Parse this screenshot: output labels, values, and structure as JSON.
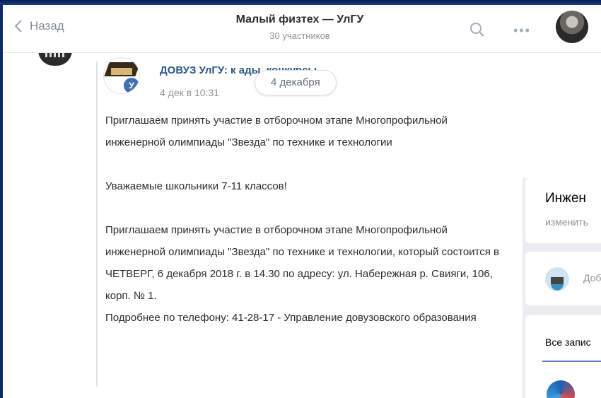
{
  "header": {
    "back_label": "Назад",
    "title": "Малый физтех — УлГУ",
    "subtitle": "30 участников"
  },
  "post": {
    "author": "ДОВУЗ УлГУ: к                 ады, конкурсы",
    "time": "4 дек в 10:31",
    "date_pill": "4 декабря",
    "avatar_letter": "У",
    "paragraphs": [
      "Приглашаем принять участие в отборочном этапе Многопрофильной инженерной олимпиады \"Звезда\" по технике и технологии",
      "Уважаемые школьники 7-11 классов!",
      "Приглашаем принять участие в отборочном этапе Многопрофильной инженерной олимпиады \"Звезда\" по технике и технологии, который состоится в ЧЕТВЕРГ, 6 декабря 2018 г. в 14.30 по адресу: ул. Набережная р. Свияги, 106, корп. № 1.",
      "Подробнее по телефону: 41-28-17 - Управление довузовского образования"
    ]
  },
  "sidebar": {
    "card_title": "Инжен",
    "card_edit": "изменить",
    "add_label": "Доб",
    "tab_all_posts": "Все запис"
  },
  "icons": {
    "back": "chevron-left-icon",
    "search": "search-icon",
    "more": "more-icon"
  },
  "colors": {
    "link": "#2a5885",
    "muted": "#939393",
    "accent": "#5181b8",
    "frame": "#0f2a66"
  }
}
